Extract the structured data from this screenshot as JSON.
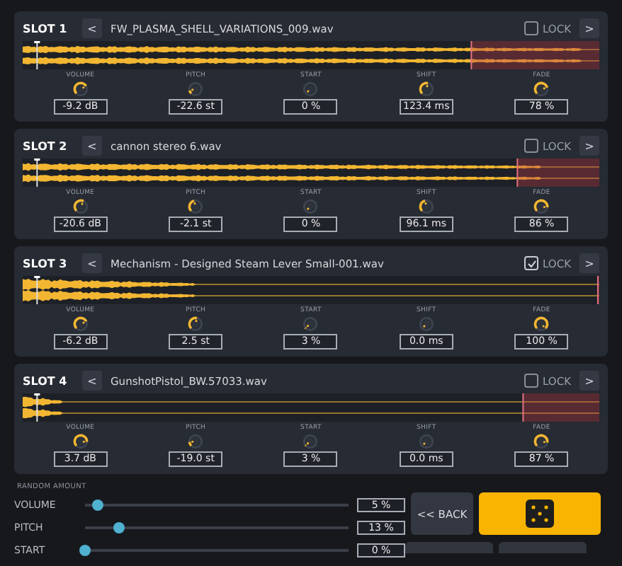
{
  "slots": [
    {
      "label": "SLOT 1",
      "prev": "<",
      "next": ">",
      "filename": "FW_PLASMA_SHELL_VARIATIONS_009.wav",
      "lock": {
        "label": "LOCK",
        "checked": false
      },
      "params": [
        {
          "label": "VOLUME",
          "reading": "-9.2 dB"
        },
        {
          "label": "PITCH",
          "reading": "-22.6 st"
        },
        {
          "label": "START",
          "reading": "0 %"
        },
        {
          "label": "SHIFT",
          "reading": "123.4 ms"
        },
        {
          "label": "FADE",
          "reading": "78 %"
        }
      ]
    },
    {
      "label": "SLOT 2",
      "prev": "<",
      "next": ">",
      "filename": "cannon stereo 6.wav",
      "lock": {
        "label": "LOCK",
        "checked": false
      },
      "params": [
        {
          "label": "VOLUME",
          "reading": "-20.6 dB"
        },
        {
          "label": "PITCH",
          "reading": "-2.1 st"
        },
        {
          "label": "START",
          "reading": "0 %"
        },
        {
          "label": "SHIFT",
          "reading": "96.1 ms"
        },
        {
          "label": "FADE",
          "reading": "86 %"
        }
      ]
    },
    {
      "label": "SLOT 3",
      "prev": "<",
      "next": ">",
      "filename": "Mechanism -  Designed Steam Lever Small-001.wav",
      "lock": {
        "label": "LOCK",
        "checked": true
      },
      "params": [
        {
          "label": "VOLUME",
          "reading": "-6.2 dB"
        },
        {
          "label": "PITCH",
          "reading": "2.5 st"
        },
        {
          "label": "START",
          "reading": "3 %"
        },
        {
          "label": "SHIFT",
          "reading": "0.0 ms"
        },
        {
          "label": "FADE",
          "reading": "100 %"
        }
      ]
    },
    {
      "label": "SLOT 4",
      "prev": "<",
      "next": ">",
      "filename": "GunshotPistol_BW.57033.wav",
      "lock": {
        "label": "LOCK",
        "checked": false
      },
      "params": [
        {
          "label": "VOLUME",
          "reading": "3.7 dB"
        },
        {
          "label": "PITCH",
          "reading": "-19.0 st"
        },
        {
          "label": "START",
          "reading": "3 %"
        },
        {
          "label": "SHIFT",
          "reading": "0.0 ms"
        },
        {
          "label": "FADE",
          "reading": "87 %"
        }
      ]
    }
  ],
  "random_amount": {
    "title": "RANDOM AMOUNT",
    "rows": [
      {
        "label": "VOLUME",
        "level": 0.05,
        "reading": "5 %"
      },
      {
        "label": "PITCH",
        "level": 0.13,
        "reading": "13 %"
      },
      {
        "label": "START",
        "level": 0.0,
        "reading": "0 %"
      }
    ]
  },
  "back_button": "<< BACK"
}
